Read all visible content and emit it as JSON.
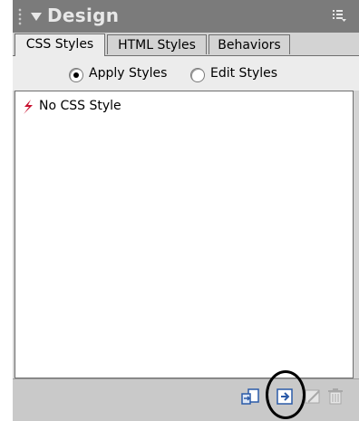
{
  "panel": {
    "title": "Design",
    "tabs": [
      {
        "label": "CSS Styles",
        "active": true
      },
      {
        "label": "HTML Styles",
        "active": false
      },
      {
        "label": "Behaviors",
        "active": false
      }
    ],
    "mode_options": [
      {
        "label": "Apply Styles",
        "selected": true
      },
      {
        "label": "Edit Styles",
        "selected": false
      }
    ],
    "styles_list": [
      {
        "label": "No CSS Style",
        "icon": "no-style-icon"
      }
    ],
    "toolbar": {
      "attach_icon": "attach-style-sheet-icon",
      "new_icon": "new-style-icon",
      "edit_icon": "edit-style-sheet-icon",
      "delete_icon": "trash-icon",
      "highlighted_button": "new-style-icon"
    }
  },
  "colors": {
    "titlebar": "#7b7b7b",
    "panel": "#d3d3d3",
    "highlight_circle": "#000000",
    "no_style_icon": "#c8102e"
  }
}
